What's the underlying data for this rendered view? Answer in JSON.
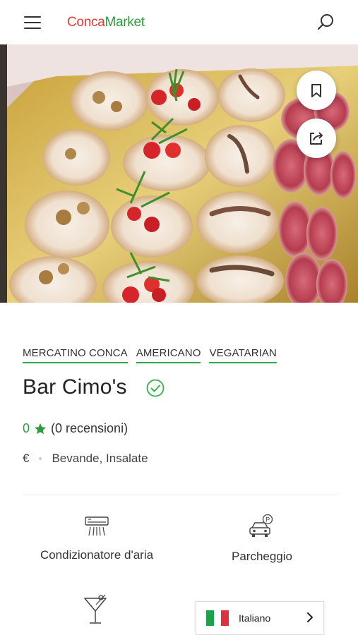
{
  "header": {
    "logo_part1": "Conca",
    "logo_part2": "Market",
    "menu_icon": "hamburger-icon",
    "search_icon": "search-icon"
  },
  "hero": {
    "bookmark_icon": "bookmark-icon",
    "share_icon": "share-icon"
  },
  "venue": {
    "tags": [
      "MERCATINO CONCA",
      "AMERICANO",
      "VEGATARIAN"
    ],
    "name": "Bar Cimo's",
    "verified_icon": "check-circle-icon",
    "rating_value": "0",
    "reviews_text": "(0 recensioni)",
    "price": "€",
    "categories": "Bevande, Insalate"
  },
  "amenities": [
    {
      "label": "Condizionatore d'aria",
      "icon": "air-conditioner-icon"
    },
    {
      "label": "Parcheggio",
      "icon": "parking-icon"
    },
    {
      "label": "",
      "icon": "cocktail-icon"
    }
  ],
  "language": {
    "label": "Italiano",
    "flag": "italy-flag",
    "colors": {
      "green": "#1fa04a",
      "white": "#ffffff",
      "red": "#e0303c"
    }
  },
  "colors": {
    "accent": "#2e9c3c",
    "logo_red": "#e53935"
  }
}
